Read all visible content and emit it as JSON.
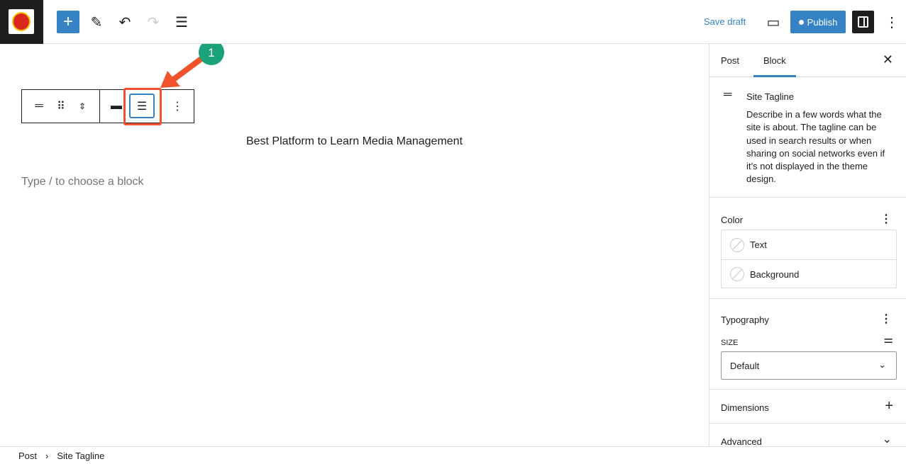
{
  "header": {
    "add_label": "+",
    "save_draft": "Save draft",
    "publish": "Publish"
  },
  "canvas": {
    "tagline": "Best Platform to Learn Media Management",
    "placeholder": "Type / to choose a block",
    "annotation_number": "1"
  },
  "sidebar": {
    "tabs": [
      {
        "label": "Post"
      },
      {
        "label": "Block"
      }
    ],
    "active_tab": "Block",
    "block": {
      "title": "Site Tagline",
      "description": "Describe in a few words what the site is about. The tagline can be used in search results or when sharing on social networks even if it’s not displayed in the theme design."
    },
    "color": {
      "title": "Color",
      "items": [
        "Text",
        "Background"
      ]
    },
    "typography": {
      "title": "Typography",
      "size_label": "SIZE",
      "size_value": "Default"
    },
    "dimensions": {
      "title": "Dimensions"
    },
    "advanced": {
      "title": "Advanced"
    }
  },
  "breadcrumb": [
    "Post",
    "Site Tagline"
  ],
  "colors": {
    "accent": "#3582c4",
    "highlight": "#f0522b",
    "badge": "#1aa37a"
  }
}
